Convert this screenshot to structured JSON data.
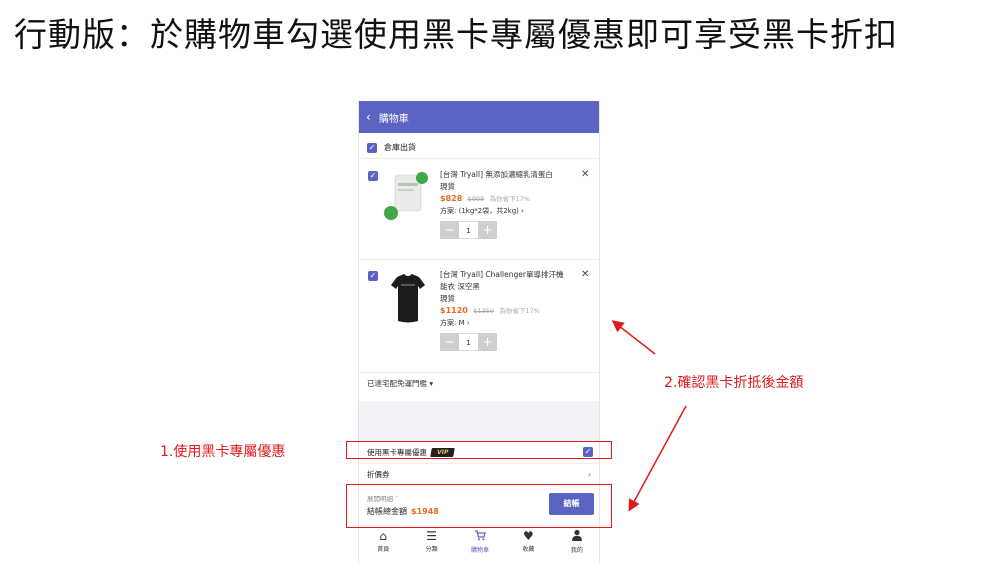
{
  "headline": "行動版：於購物車勾選使用黑卡專屬優惠即可享受黑卡折扣",
  "app": {
    "title": "購物車",
    "store_label": "倉庫出貨"
  },
  "items": [
    {
      "title": "[台灣 Tryall] 無添加濃縮乳清蛋白",
      "stock": "現貨",
      "price": "$828",
      "old_price": "$998",
      "save": "為你省下17%",
      "plan": "方案: (1kg*2袋，共2kg)",
      "qty": "1"
    },
    {
      "title": "[台灣 Tryall] Challenger單導排汗機能衣 深空黑",
      "stock": "現貨",
      "price": "$1120",
      "old_price": "$1350",
      "save": "為你省下17%",
      "plan": "方案: M",
      "qty": "1"
    }
  ],
  "shipping_label": "已達宅配免運門檻",
  "vip": {
    "label": "使用黑卡專屬優惠",
    "badge": "VIP",
    "checked": true
  },
  "coupon_label": "折價券",
  "summary": {
    "detail_label": "展開明細",
    "total_label": "結帳總金額",
    "total_amount": "$1948",
    "checkout_label": "結帳"
  },
  "tabs": [
    {
      "label": "首頁",
      "icon": "home-icon"
    },
    {
      "label": "分類",
      "icon": "menu-icon"
    },
    {
      "label": "購物車",
      "icon": "cart-icon",
      "active": true
    },
    {
      "label": "收藏",
      "icon": "heart-icon"
    },
    {
      "label": "我的",
      "icon": "user-icon"
    }
  ],
  "annotations": {
    "step1": "1.使用黑卡專屬優惠",
    "step2": "2.確認黑卡折抵後金額"
  },
  "colors": {
    "brand": "#5b63c3",
    "price": "#e86a1e",
    "annotation": "#e0191b"
  }
}
